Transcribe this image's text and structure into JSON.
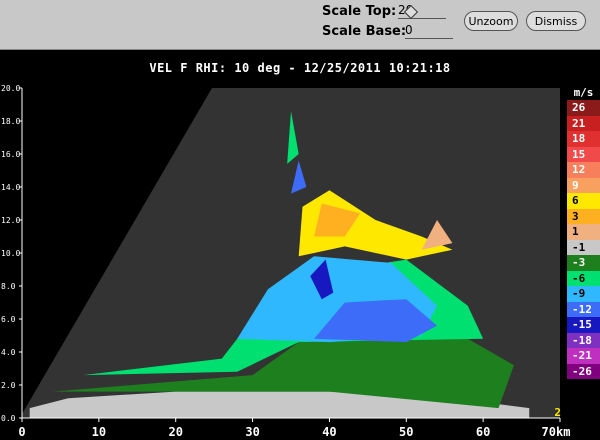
{
  "toolbar": {
    "scale_top_label": "Scale Top:",
    "scale_top_value": "20",
    "scale_base_label": "Scale Base:",
    "scale_base_value": "0",
    "unzoom_label": "Unzoom",
    "dismiss_label": "Dismiss"
  },
  "title": "VEL F  RHI: 10 deg  -  12/25/2011 10:21:18",
  "plot": {
    "background_color": "#333333",
    "no_data_color": "#000000"
  },
  "chart_data": {
    "type": "heatmap",
    "title": "VEL F  RHI: 10 deg  -  12/25/2011 10:21:18",
    "xlabel": "km",
    "ylabel": "",
    "xlim": [
      0,
      70
    ],
    "ylim": [
      0,
      20
    ],
    "x_ticks": [
      "0",
      "10",
      "20",
      "30",
      "40",
      "50",
      "60",
      "70km"
    ],
    "y_ticks": [
      "0.0",
      "2.0",
      "4.0",
      "6.0",
      "8.0",
      "10.0",
      "12.0",
      "14.0",
      "16.0",
      "18.0",
      "20.0"
    ],
    "colorbar_unit": "m/s",
    "corner_label": "2",
    "colorbar": [
      {
        "label": "26",
        "color": "#8b1a1a",
        "text": "#ffffff"
      },
      {
        "label": "21",
        "color": "#c82020",
        "text": "#ffffff"
      },
      {
        "label": "18",
        "color": "#e03030",
        "text": "#ffffff"
      },
      {
        "label": "15",
        "color": "#f04a4a",
        "text": "#ffffff"
      },
      {
        "label": "12",
        "color": "#f87f5c",
        "text": "#ffffff"
      },
      {
        "label": "9",
        "color": "#f8a060",
        "text": "#ffffff"
      },
      {
        "label": "6",
        "color": "#ffe800",
        "text": "#000000"
      },
      {
        "label": "3",
        "color": "#ffb020",
        "text": "#000000"
      },
      {
        "label": "1",
        "color": "#f0b080",
        "text": "#000000"
      },
      {
        "label": "-1",
        "color": "#c8c8c8",
        "text": "#000000"
      },
      {
        "label": "-3",
        "color": "#1e7f1e",
        "text": "#ffffff"
      },
      {
        "label": "-6",
        "color": "#00e070",
        "text": "#000000"
      },
      {
        "label": "-9",
        "color": "#30b8ff",
        "text": "#000000"
      },
      {
        "label": "-12",
        "color": "#3c6cf8",
        "text": "#ffffff"
      },
      {
        "label": "-15",
        "color": "#1818c0",
        "text": "#ffffff"
      },
      {
        "label": "-18",
        "color": "#8030c0",
        "text": "#ffffff"
      },
      {
        "label": "-21",
        "color": "#c030c0",
        "text": "#ffffff"
      },
      {
        "label": "-26",
        "color": "#800080",
        "text": "#ffffff"
      }
    ]
  }
}
